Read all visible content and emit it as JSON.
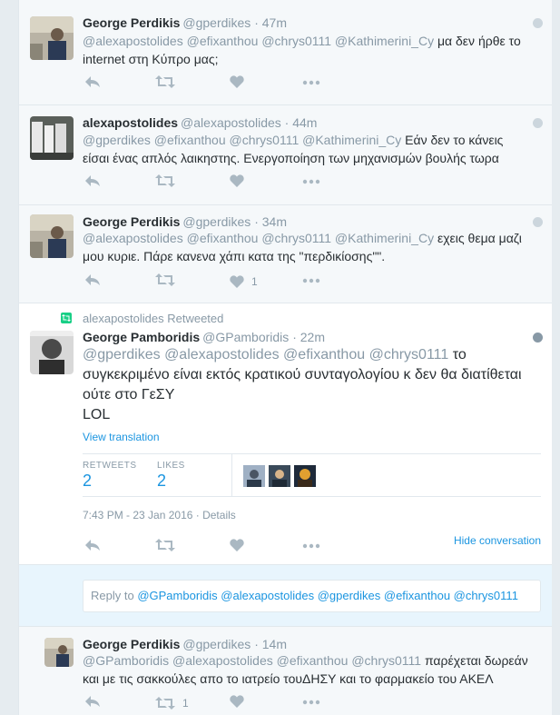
{
  "tweets": [
    {
      "fullname": "George Perdikis",
      "username": "@gperdikes",
      "time": "47m",
      "mentions": "@alexapostolides @efixanthou @chrys0111 @Kathimerini_Cy",
      "line1_rest": "μα δεν ήρθε το",
      "line2": "internet στη Κύπρο μας;",
      "like_count": ""
    },
    {
      "fullname": "alexapostolides",
      "username": "@alexapostolides",
      "time": "44m",
      "mentions": "@gperdikes @efixanthou @chrys0111 @Kathimerini_Cy",
      "line1_rest": "Εάν δεν το κάνεις",
      "line2": "είσαι ένας απλός λαικηστης.  Ενεργοποίηση των μηχανισμών βουλής τωρα",
      "like_count": ""
    },
    {
      "fullname": "George Perdikis",
      "username": "@gperdikes",
      "time": "34m",
      "mentions": "@alexapostolides @efixanthou @chrys0111 @Kathimerini_Cy",
      "line1_rest": "εχεις θεμα μαζι",
      "line2": "μου κυριε. Πάρε κανενα χάπι κατα της \"περδικίοσης\"\".",
      "like_count": "1"
    }
  ],
  "main": {
    "retweeted_by": "alexapostolides Retweeted",
    "fullname": "George Pamboridis",
    "username": "@GPamboridis",
    "time": "22m",
    "mentions": "@gperdikes @alexapostolides @efixanthou @chrys0111",
    "line1_rest": "το",
    "line2": "συγκεκριμένο είναι εκτός κρατικού συνταγολογίου κ δεν θα διατίθεται",
    "line3": "ούτε στο ΓεΣΥ",
    "line4": "LOL",
    "view_translation": "View translation",
    "retweets_label": "RETWEETS",
    "retweets_value": "2",
    "likes_label": "LIKES",
    "likes_value": "2",
    "timestamp": "7:43 PM - 23 Jan 2016",
    "details": "Details",
    "hide_conversation": "Hide conversation"
  },
  "reply": {
    "prefix": "Reply to",
    "mentions": "@GPamboridis @alexapostolides @gperdikes @efixanthou @chrys0111"
  },
  "last_reply": {
    "fullname": "George Perdikis",
    "username": "@gperdikes",
    "time": "14m",
    "mentions": "@GPamboridis @alexapostolides @efixanthou @chrys0111",
    "line1_rest": "παρέχεται δωρεάν",
    "line2": "και με τις σακκούλες απο το ιατρείο τουΔΗΣΥ και το φαρμακείο του ΑΚΕΛ",
    "retweet_count": "1"
  },
  "colors": {
    "accent": "#1b95e0",
    "muted": "#8899a6",
    "retweet_green": "#19cf86"
  },
  "icons": [
    "reply-icon",
    "retweet-icon",
    "heart-icon",
    "more-icon",
    "globe-icon",
    "retweet-badge-icon"
  ]
}
